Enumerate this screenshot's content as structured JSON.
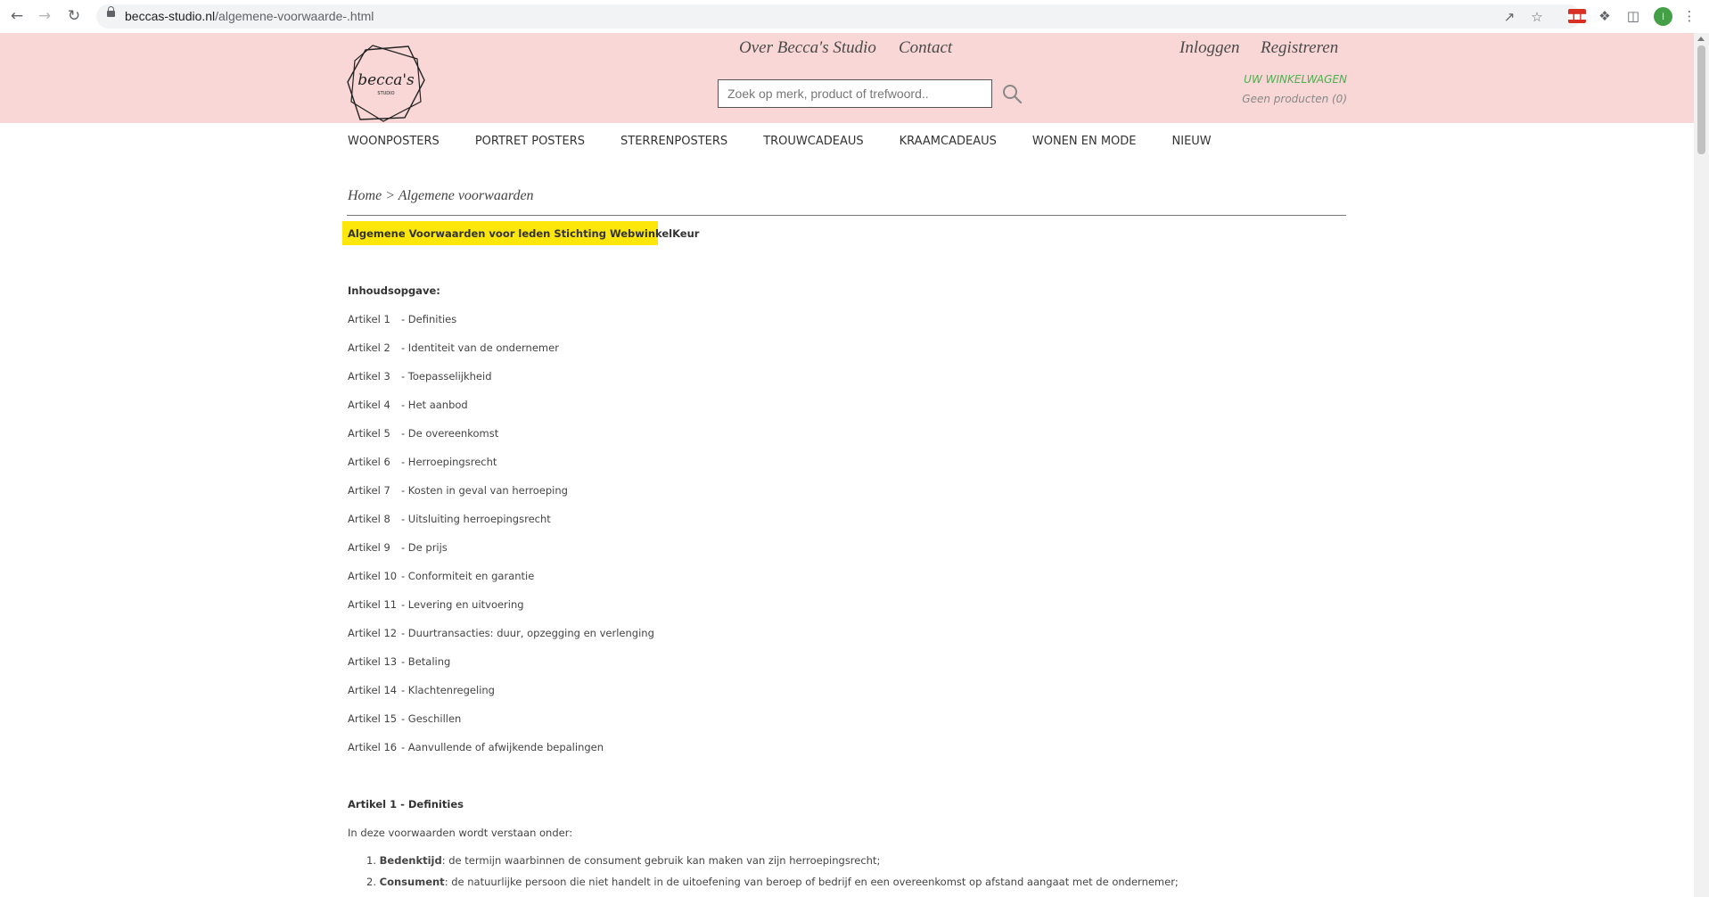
{
  "browser": {
    "url_host": "beccas-studio.nl",
    "url_path": "/algemene-voorwaarde-.html",
    "profile_initial": "I"
  },
  "header": {
    "logo_text": "becca's",
    "logo_subtext": "STUDIO",
    "links": [
      "Over Becca's Studio",
      "Contact"
    ],
    "account_links": [
      "Inloggen",
      "Registreren"
    ],
    "search_placeholder": "Zoek op merk, product of trefwoord..",
    "cart_title": "UW WINKELWAGEN",
    "cart_status": "Geen producten (0)"
  },
  "nav": {
    "items": [
      "WOONPOSTERS",
      "PORTRET POSTERS",
      "STERRENPOSTERS",
      "TROUWCADEAUS",
      "KRAAMCADEAUS",
      "WONEN EN MODE",
      "NIEUW"
    ]
  },
  "breadcrumb": {
    "home": "Home",
    "separator": ">",
    "current": "Algemene voorwaarden"
  },
  "content": {
    "heading": "Algemene Voorwaarden voor leden Stichting WebwinkelKeur",
    "toc_title": "Inhoudsopgave:",
    "toc": [
      {
        "num": "Artikel   1",
        "title": "- Definities"
      },
      {
        "num": "Artikel   2",
        "title": "- Identiteit van de ondernemer"
      },
      {
        "num": "Artikel   3",
        "title": "- Toepasselijkheid"
      },
      {
        "num": "Artikel   4",
        "title": "- Het aanbod"
      },
      {
        "num": "Artikel   5",
        "title": "- De overeenkomst"
      },
      {
        "num": "Artikel   6",
        "title": "- Herroepingsrecht"
      },
      {
        "num": "Artikel   7",
        "title": "- Kosten in geval van herroeping"
      },
      {
        "num": "Artikel   8",
        "title": "- Uitsluiting herroepingsrecht"
      },
      {
        "num": "Artikel   9",
        "title": "- De prijs"
      },
      {
        "num": "Artikel 10",
        "title": "- Conformiteit en garantie"
      },
      {
        "num": "Artikel 11",
        "title": "- Levering en uitvoering"
      },
      {
        "num": "Artikel 12",
        "title": "- Duurtransacties: duur, opzegging en verlenging"
      },
      {
        "num": "Artikel 13",
        "title": "- Betaling"
      },
      {
        "num": "Artikel 14",
        "title": "- Klachtenregeling"
      },
      {
        "num": "Artikel 15",
        "title": "- Geschillen"
      },
      {
        "num": "Artikel 16",
        "title": "- Aanvullende of afwijkende bepalingen"
      }
    ],
    "article1_title": "Artikel 1 - Definities",
    "article1_intro": "In deze voorwaarden wordt verstaan onder:",
    "definitions": [
      {
        "idx": "1.",
        "term": "Bedenktijd",
        "text": ": de termijn waarbinnen de consument gebruik kan maken van zijn herroepingsrecht;"
      },
      {
        "idx": "2.",
        "term": "Consument",
        "text": ": de natuurlijke persoon die niet handelt in de uitoefening van beroep of bedrijf en een overeenkomst op afstand aangaat met de ondernemer;"
      }
    ]
  }
}
